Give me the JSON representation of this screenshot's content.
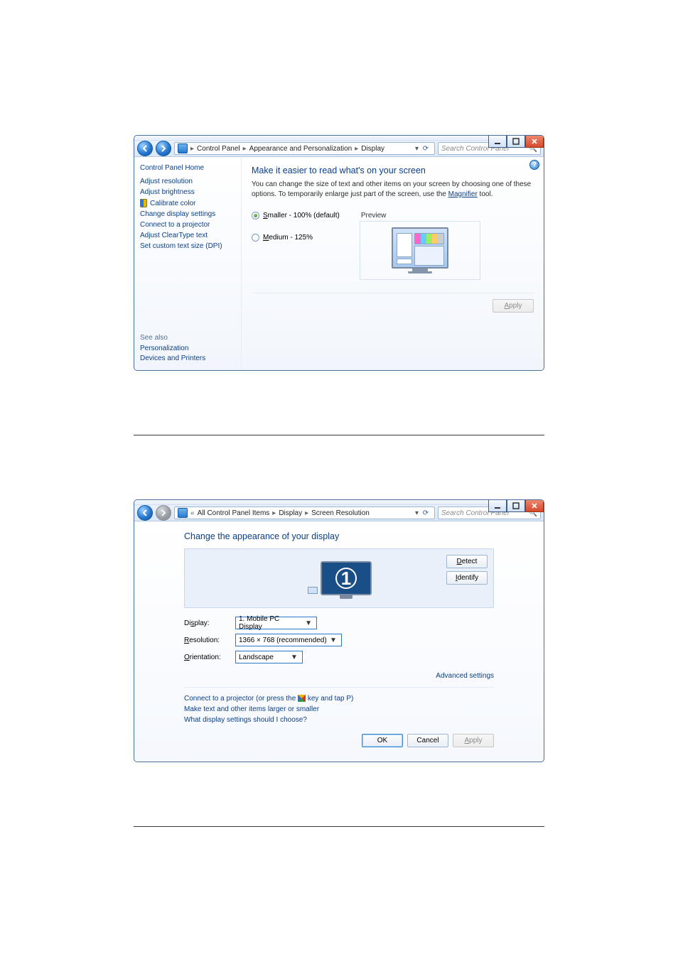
{
  "win_common": {
    "search_placeholder": "Search Control Panel"
  },
  "window1": {
    "breadcrumb": [
      "Control Panel",
      "Appearance and Personalization",
      "Display"
    ],
    "sidebar": {
      "home": "Control Panel Home",
      "links": {
        "adjust_resolution": "Adjust resolution",
        "adjust_brightness": "Adjust brightness",
        "calibrate_color": "Calibrate color",
        "change_display_settings": "Change display settings",
        "connect_projector": "Connect to a projector",
        "adjust_cleartype": "Adjust ClearType text",
        "set_custom_dpi": "Set custom text size (DPI)"
      },
      "see_also_title": "See also",
      "see_also": {
        "personalization": "Personalization",
        "devices_printers": "Devices and Printers"
      }
    },
    "main": {
      "heading": "Make it easier to read what's on your screen",
      "desc_pre": "You can change the size of text and other items on your screen by choosing one of these options. To temporarily enlarge just part of the screen, use the ",
      "desc_link": "Magnifier",
      "desc_post": " tool.",
      "radio_smaller_pre": "S",
      "radio_smaller_rest": "maller - 100% (default)",
      "radio_medium_pre": "M",
      "radio_medium_rest": "edium - 125%",
      "preview_label": "Preview",
      "apply_u": "A",
      "apply_rest": "pply"
    }
  },
  "window2": {
    "breadcrumb_leading": "«",
    "breadcrumb": [
      "All Control Panel Items",
      "Display",
      "Screen Resolution"
    ],
    "heading": "Change the appearance of your display",
    "monitor_number": "1",
    "detect_u": "D",
    "detect_rest": "etect",
    "identify_u": "I",
    "identify_rest": "dentify",
    "row_display_u": "s",
    "row_display_label_pre": "Di",
    "row_display_label_post": "play:",
    "row_display_value": "1. Mobile PC Display",
    "row_resolution_u": "R",
    "row_resolution_label_rest": "esolution:",
    "row_resolution_value": "1366 × 768 (recommended)",
    "row_orientation_u": "O",
    "row_orientation_label_rest": "rientation:",
    "row_orientation_value": "Landscape",
    "advanced_settings": "Advanced settings",
    "link_projector_pre": "Connect to a projector (or press the ",
    "link_projector_post": " key and tap P)",
    "link_textsize": "Make text and other items larger or smaller",
    "link_which": "What display settings should I choose?",
    "ok": "OK",
    "cancel": "Cancel",
    "apply_u": "A",
    "apply_rest": "pply"
  }
}
